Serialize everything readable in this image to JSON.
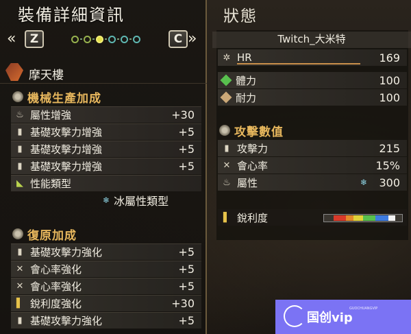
{
  "equipment": {
    "title": "裝備詳細資訊",
    "nav": {
      "left_chevron": "«",
      "left_key": "Z",
      "right_key": "C",
      "right_chevron": "»"
    },
    "weapon_name": "摩天樓",
    "sections": [
      {
        "title": "機械生產加成",
        "rows": [
          {
            "icon": "element-icon",
            "label": "屬性增強",
            "value": "+30"
          },
          {
            "icon": "attack-icon",
            "label": "基礎攻擊力增強",
            "value": "+5"
          },
          {
            "icon": "attack-icon",
            "label": "基礎攻擊力增強",
            "value": "+5"
          },
          {
            "icon": "attack-icon",
            "label": "基礎攻擊力增強",
            "value": "+5"
          },
          {
            "icon": "type-icon",
            "label": "性能類型",
            "value": ""
          }
        ],
        "subtype": "冰屬性類型"
      },
      {
        "title": "復原加成",
        "rows": [
          {
            "icon": "attack-icon",
            "label": "基礎攻擊力強化",
            "value": "+5"
          },
          {
            "icon": "affinity-icon",
            "label": "會心率強化",
            "value": "+5"
          },
          {
            "icon": "affinity-icon",
            "label": "會心率強化",
            "value": "+5"
          },
          {
            "icon": "sharpness-icon",
            "label": "銳利度強化",
            "value": "+30"
          },
          {
            "icon": "attack-icon",
            "label": "基礎攻擊力強化",
            "value": "+5"
          }
        ]
      }
    ]
  },
  "status": {
    "title": "狀態",
    "player_name": "Twitch_大米特",
    "hr": {
      "label": "HR",
      "value": "169"
    },
    "health": {
      "label": "體力",
      "value": "100"
    },
    "stamina": {
      "label": "耐力",
      "value": "100"
    },
    "attack_section_title": "攻擊數值",
    "attack": {
      "label": "攻擊力",
      "value": "215"
    },
    "affinity": {
      "label": "會心率",
      "value": "15%"
    },
    "element": {
      "label": "屬性",
      "value": "300"
    },
    "sharpness": {
      "label": "銳利度",
      "segments": [
        {
          "color": "#d83a2a",
          "fraction": 0.18
        },
        {
          "color": "#e38a2a",
          "fraction": 0.12
        },
        {
          "color": "#e0d23a",
          "fraction": 0.14
        },
        {
          "color": "#58c04e",
          "fraction": 0.18
        },
        {
          "color": "#3e7be0",
          "fraction": 0.2
        },
        {
          "color": "#f2f2f2",
          "fraction": 0.1
        }
      ]
    }
  },
  "colors": {
    "accent_gold": "#e7b75d",
    "health_green": "#58c04e",
    "stamina_tan": "#cba877",
    "watermark_bg": "#7b73f4"
  },
  "watermark": {
    "text": "国创vip",
    "subtext": "GUOCHUANGVIP"
  }
}
